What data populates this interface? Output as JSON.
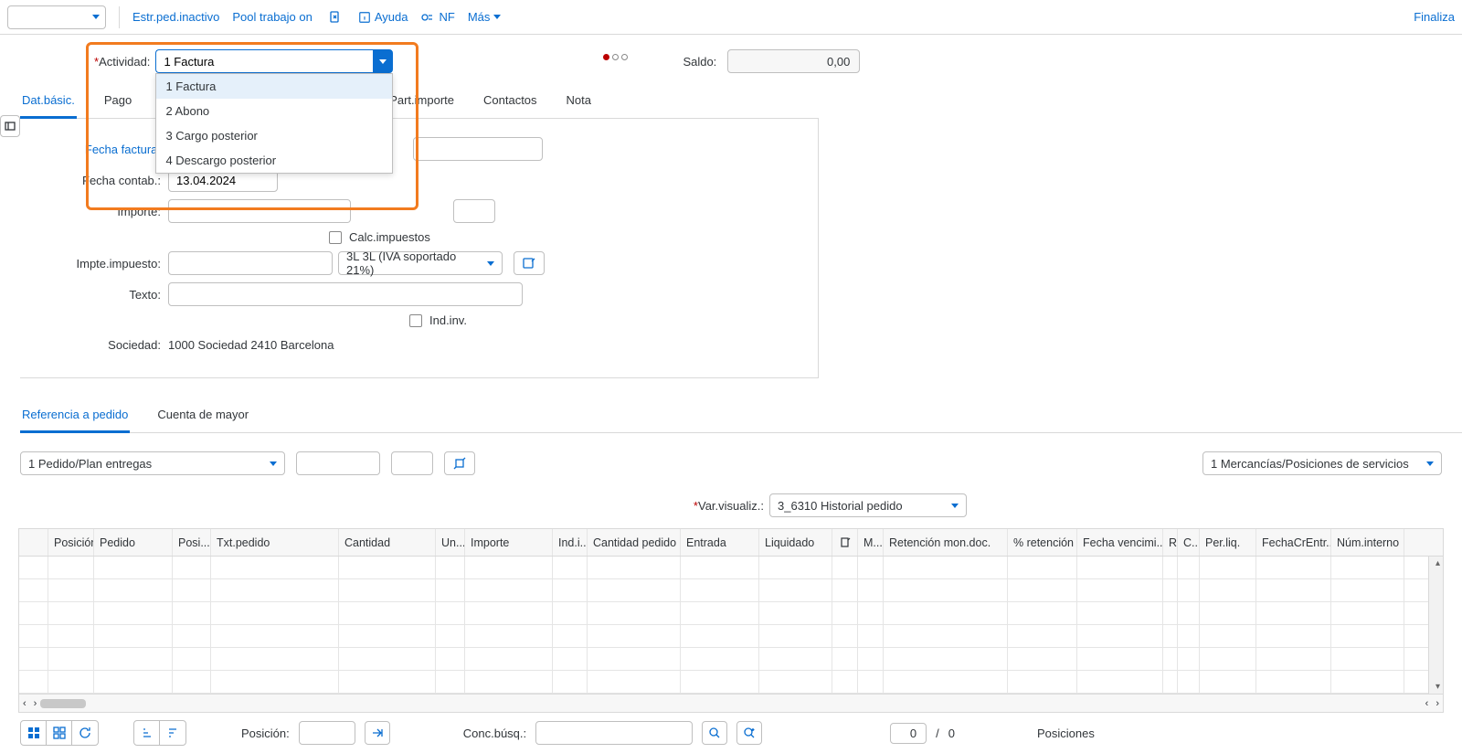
{
  "toolbar": {
    "estr_ped": "Estr.ped.inactivo",
    "pool": "Pool trabajo on",
    "ayuda": "Ayuda",
    "nf": "NF",
    "mas": "Más",
    "finalizar": "Finaliza"
  },
  "actividad": {
    "label": "Actividad:",
    "value": "1 Factura",
    "options": [
      "1 Factura",
      "2 Abono",
      "3 Cargo posterior",
      "4 Descargo posterior"
    ]
  },
  "saldo": {
    "label": "Saldo:",
    "value": "0,00"
  },
  "tabs": [
    "Dat.básic.",
    "Pago",
    "Part.importe",
    "Contactos",
    "Nota"
  ],
  "form": {
    "fecha_factura_label": "Fecha factura:",
    "fecha_contab_label": "Fecha contab.:",
    "fecha_contab_value": "13.04.2024",
    "importe_label": "Importe:",
    "calc_impuestos": "Calc.impuestos",
    "impte_impuesto_label": "Impte.impuesto:",
    "tax_code": "3L 3L (IVA soportado 21%)",
    "texto_label": "Texto:",
    "ind_inv": "Ind.inv.",
    "sociedad_label": "Sociedad:",
    "sociedad_value": "1000 Sociedad 2410 Barcelona"
  },
  "lower_tabs": [
    "Referencia a pedido",
    "Cuenta de mayor"
  ],
  "ref": {
    "pedido_select": "1 Pedido/Plan entregas",
    "mercancias": "1 Mercancías/Posiciones de servicios",
    "var_label": "Var.visualiz.:",
    "var_value": "3_6310 Historial pedido"
  },
  "columns": [
    "",
    "Posición",
    "Pedido",
    "Posi...",
    "Txt.pedido",
    "Cantidad",
    "Un...",
    "Importe",
    "Ind.i...",
    "Cantidad pedido",
    "Entrada",
    "Liquidado",
    "",
    "M...",
    "Retención mon.doc.",
    "% retención",
    "Fecha vencimi...",
    "R",
    "C...",
    "Per.liq.",
    "FechaCrEntr...",
    "Núm.interno"
  ],
  "footer": {
    "posicion_label": "Posición:",
    "conc_busq_label": "Conc.búsq.:",
    "count": "0",
    "total": "0",
    "posiciones": "Posiciones"
  }
}
